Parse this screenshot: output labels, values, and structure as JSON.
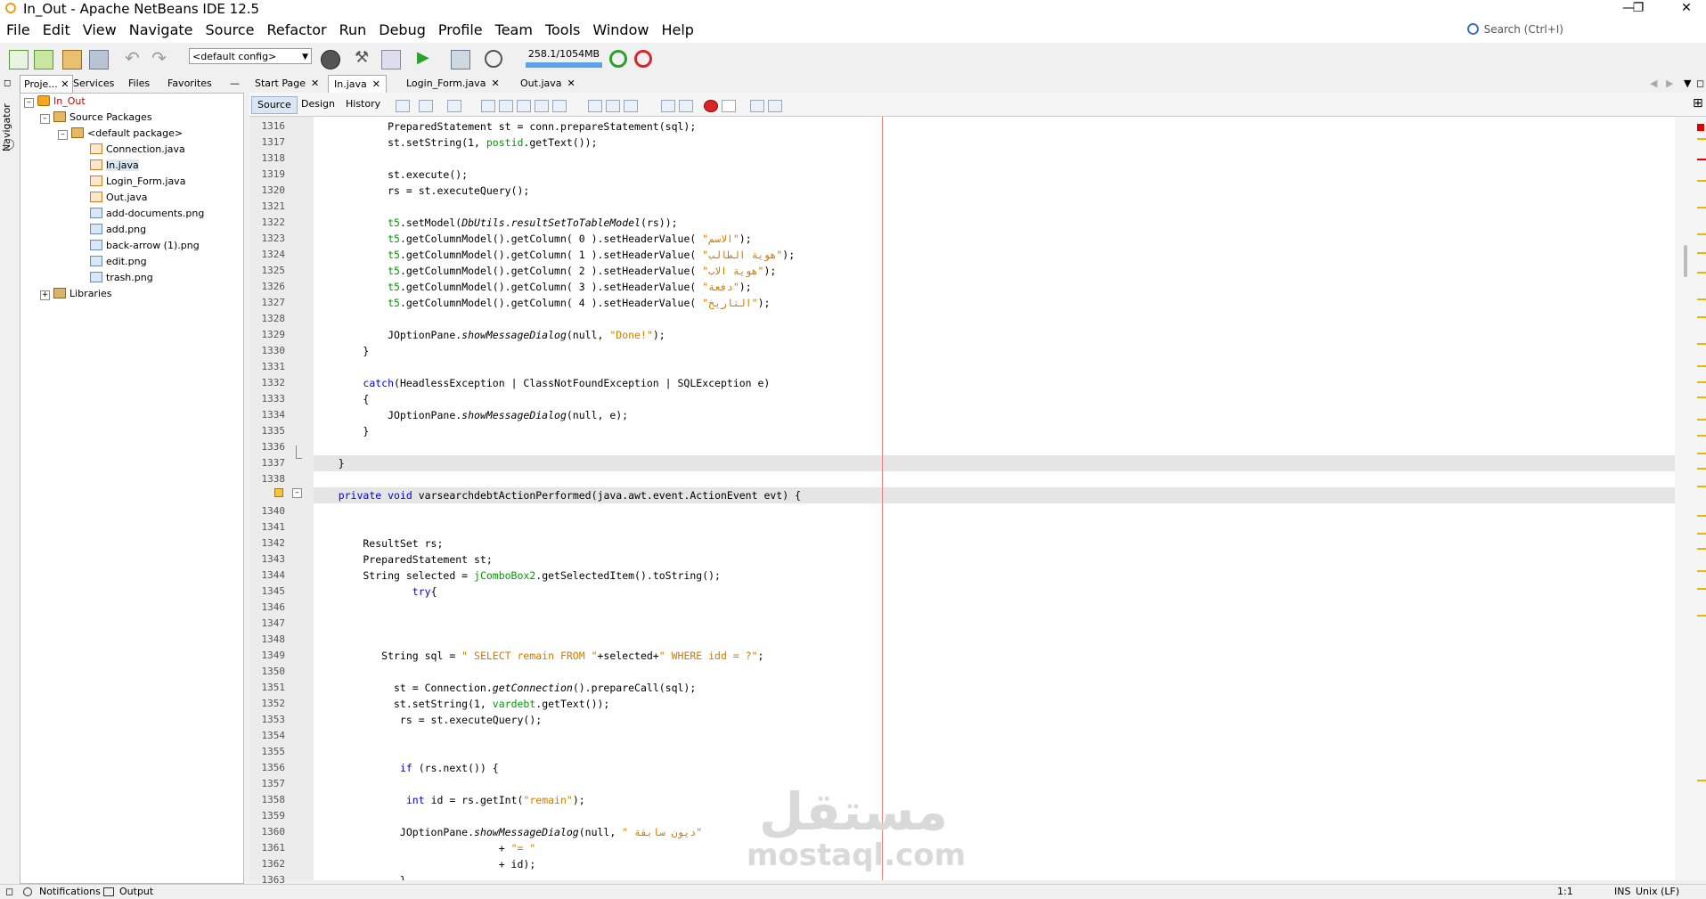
{
  "window": {
    "title": "In_Out - Apache NetBeans IDE 12.5"
  },
  "menu": [
    "File",
    "Edit",
    "View",
    "Navigate",
    "Source",
    "Refactor",
    "Run",
    "Debug",
    "Profile",
    "Team",
    "Tools",
    "Window",
    "Help"
  ],
  "search": {
    "placeholder": "Search (Ctrl+I)"
  },
  "toolbar": {
    "config": "<default config>",
    "memory": "258.1/1054MB"
  },
  "left_tabs": [
    "Proje...",
    "Services",
    "Files",
    "Favorites"
  ],
  "navigator_label": "Navigator",
  "tree": {
    "project": "In_Out",
    "source_packages": "Source Packages",
    "default_package": "<default package>",
    "files": [
      "Connection.java",
      "In.java",
      "Login_Form.java",
      "Out.java",
      "add-documents.png",
      "add.png",
      "back-arrow (1).png",
      "edit.png",
      "trash.png"
    ],
    "libraries": "Libraries"
  },
  "editor_tabs": [
    "Start Page",
    "In.java",
    "Login_Form.java",
    "Out.java"
  ],
  "view_tabs": [
    "Source",
    "Design",
    "History"
  ],
  "code_lines": [
    {
      "n": "1316",
      "t": "            PreparedStatement st = conn.prepareStatement(sql);"
    },
    {
      "n": "1317",
      "t": "            st.setString(1, postid.getText());"
    },
    {
      "n": "1318",
      "t": ""
    },
    {
      "n": "1319",
      "t": "            st.execute();"
    },
    {
      "n": "1320",
      "t": "            rs = st.executeQuery();"
    },
    {
      "n": "1321",
      "t": ""
    },
    {
      "n": "1322",
      "t": "            t5.setModel(DbUtils.resultSetToTableModel(rs));"
    },
    {
      "n": "1323",
      "t": "            t5.getColumnModel().getColumn( 0 ).setHeaderValue( \"الاسم\");"
    },
    {
      "n": "1324",
      "t": "            t5.getColumnModel().getColumn( 1 ).setHeaderValue( \"هوية الطالب\");"
    },
    {
      "n": "1325",
      "t": "            t5.getColumnModel().getColumn( 2 ).setHeaderValue( \"هوية الاب\");"
    },
    {
      "n": "1326",
      "t": "            t5.getColumnModel().getColumn( 3 ).setHeaderValue( \"دفعة\");"
    },
    {
      "n": "1327",
      "t": "            t5.getColumnModel().getColumn( 4 ).setHeaderValue( \"التاريخ\");"
    },
    {
      "n": "1328",
      "t": ""
    },
    {
      "n": "1329",
      "t": "            JOptionPane.showMessageDialog(null, \"Done!\");"
    },
    {
      "n": "1330",
      "t": "        }"
    },
    {
      "n": "1331",
      "t": ""
    },
    {
      "n": "1332",
      "t": "        catch(HeadlessException | ClassNotFoundException | SQLException e)"
    },
    {
      "n": "1333",
      "t": "        {"
    },
    {
      "n": "1334",
      "t": "            JOptionPane.showMessageDialog(null, e);"
    },
    {
      "n": "1335",
      "t": "        }"
    },
    {
      "n": "1336",
      "t": ""
    },
    {
      "n": "1337",
      "t": "    }"
    },
    {
      "n": "1338",
      "t": ""
    },
    {
      "n": "",
      "t": "    private void varsearchdebtActionPerformed(java.awt.event.ActionEvent evt) {"
    },
    {
      "n": "1340",
      "t": ""
    },
    {
      "n": "1341",
      "t": ""
    },
    {
      "n": "1342",
      "t": "        ResultSet rs;"
    },
    {
      "n": "1343",
      "t": "        PreparedStatement st;"
    },
    {
      "n": "1344",
      "t": "        String selected = jComboBox2.getSelectedItem().toString();"
    },
    {
      "n": "1345",
      "t": "                try{"
    },
    {
      "n": "1346",
      "t": ""
    },
    {
      "n": "1347",
      "t": ""
    },
    {
      "n": "1348",
      "t": ""
    },
    {
      "n": "1349",
      "t": "           String sql = \" SELECT remain FROM \"+selected+\" WHERE idd = ?\";"
    },
    {
      "n": "1350",
      "t": ""
    },
    {
      "n": "1351",
      "t": "             st = Connection.getConnection().prepareCall(sql);"
    },
    {
      "n": "1352",
      "t": "             st.setString(1, vardebt.getText());"
    },
    {
      "n": "1353",
      "t": "              rs = st.executeQuery();"
    },
    {
      "n": "1354",
      "t": ""
    },
    {
      "n": "1355",
      "t": ""
    },
    {
      "n": "1356",
      "t": "              if (rs.next()) {"
    },
    {
      "n": "1357",
      "t": ""
    },
    {
      "n": "1358",
      "t": "               int id = rs.getInt(\"remain\");"
    },
    {
      "n": "1359",
      "t": ""
    },
    {
      "n": "1360",
      "t": "              JOptionPane.showMessageDialog(null, \" ديون سابقة\""
    },
    {
      "n": "1361",
      "t": "                              + \"= \""
    },
    {
      "n": "1362",
      "t": "                              + id);"
    },
    {
      "n": "1363",
      "t": "              }"
    }
  ],
  "status": {
    "notifications": "Notifications",
    "output": "Output",
    "position": "1:1",
    "mode": "INS",
    "eol": "Unix (LF)"
  },
  "watermark": {
    "arabic": "مستقل",
    "latin": "mostaql.com"
  },
  "colors": {
    "keyword": "#0000e6",
    "string": "#ce7b00",
    "field": "#009900",
    "margin_line": "#f08080"
  }
}
